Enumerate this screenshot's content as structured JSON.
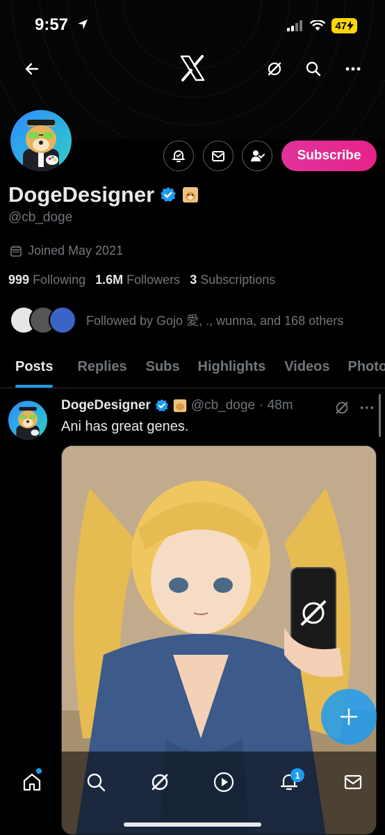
{
  "status_bar": {
    "time": "9:57",
    "battery": "47"
  },
  "profile": {
    "display_name": "DogeDesigner",
    "handle": "@cb_doge",
    "joined": "Joined May 2021",
    "following_count": "999",
    "following_label": "Following",
    "followers_count": "1.6M",
    "followers_label": "Followers",
    "subscriptions_count": "3",
    "subscriptions_label": "Subscriptions",
    "followed_by": "Followed by Gojo 愛, ., wunna, and 168 others",
    "subscribe_label": "Subscribe"
  },
  "tabs": [
    {
      "label": "Posts",
      "active": true
    },
    {
      "label": "Replies"
    },
    {
      "label": "Subs"
    },
    {
      "label": "Highlights"
    },
    {
      "label": "Videos"
    },
    {
      "label": "Photos"
    }
  ],
  "post": {
    "name": "DogeDesigner",
    "handle": "@cb_doge",
    "time": "· 48m",
    "text": "Ani has great genes."
  },
  "tabbar": {
    "notifications_badge": "1"
  },
  "colors": {
    "accent": "#1d9bf0",
    "subscribe": "#e0339b",
    "verified": "#1d9bf0"
  },
  "icons": [
    "back-arrow-icon",
    "x-logo-icon",
    "grok-icon",
    "search-icon",
    "more-icon",
    "notify-icon",
    "message-icon",
    "following-icon",
    "calendar-icon",
    "verified-icon",
    "home-icon",
    "explore-icon",
    "play-icon",
    "bell-icon",
    "mail-icon",
    "compose-icon"
  ]
}
